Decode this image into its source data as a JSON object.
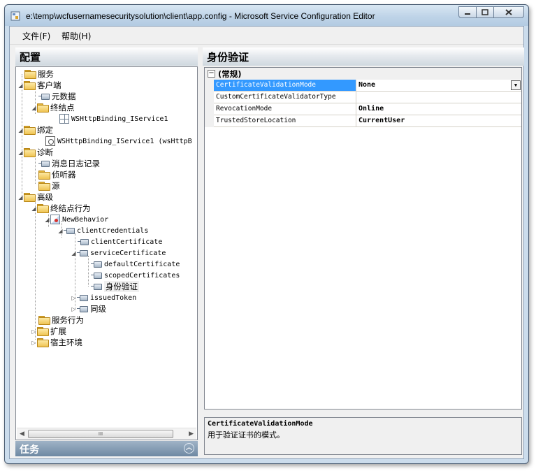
{
  "window": {
    "title": "e:\\temp\\wcfusernamesecuritysolution\\client\\app.config - Microsoft Service Configuration Editor"
  },
  "menu": {
    "file": "文件(F)",
    "help": "帮助(H)"
  },
  "left": {
    "header": "配置",
    "tasks": "任务",
    "tree": [
      {
        "label": "服务"
      },
      {
        "label": "客户端"
      },
      {
        "label": "元数据"
      },
      {
        "label": "终结点"
      },
      {
        "label": "WSHttpBinding_IService1"
      },
      {
        "label": "绑定"
      },
      {
        "label": "WSHttpBinding_IService1 (wsHttpB"
      },
      {
        "label": "诊断"
      },
      {
        "label": "消息日志记录"
      },
      {
        "label": "侦听器"
      },
      {
        "label": "源"
      },
      {
        "label": "高级"
      },
      {
        "label": "终结点行为"
      },
      {
        "label": "NewBehavior"
      },
      {
        "label": "clientCredentials"
      },
      {
        "label": "clientCertificate"
      },
      {
        "label": "serviceCertificate"
      },
      {
        "label": "defaultCertificate"
      },
      {
        "label": "scopedCertificates"
      },
      {
        "label": "身份验证"
      },
      {
        "label": "issuedToken"
      },
      {
        "label": "同级"
      },
      {
        "label": "服务行为"
      },
      {
        "label": "扩展"
      },
      {
        "label": "宿主环境"
      }
    ],
    "scroll_thumb": "III"
  },
  "right": {
    "header": "身份验证",
    "category": "(常规)",
    "properties": [
      {
        "name": "CertificateValidationMode",
        "value": "None"
      },
      {
        "name": "CustomCertificateValidatorType",
        "value": ""
      },
      {
        "name": "RevocationMode",
        "value": "Online"
      },
      {
        "name": "TrustedStoreLocation",
        "value": "CurrentUser"
      }
    ],
    "description": {
      "title": "CertificateValidationMode",
      "text": "用于验证证书的模式。"
    }
  },
  "colors": {
    "selection": "#3399ff",
    "frame": "#cbdcec"
  }
}
